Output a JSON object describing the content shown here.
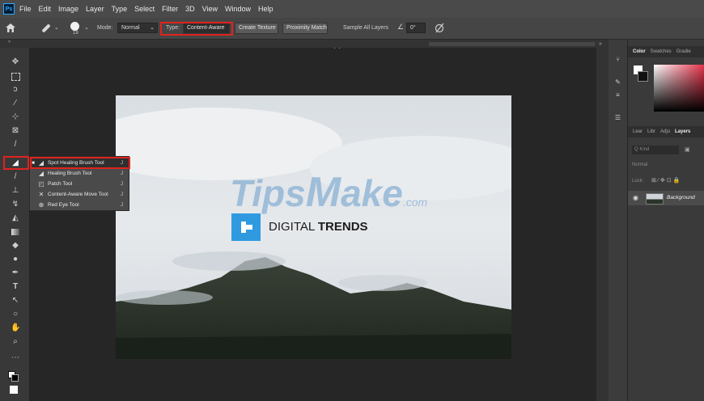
{
  "app": {
    "logo": "Ps"
  },
  "menubar": {
    "items": [
      "File",
      "Edit",
      "Image",
      "Layer",
      "Type",
      "Select",
      "Filter",
      "3D",
      "View",
      "Window",
      "Help"
    ]
  },
  "options": {
    "brush_size": "19",
    "mode_label": "Mode:",
    "mode_value": "Normal",
    "type_label": "Type:",
    "type_value": "Content-Aware",
    "create_texture": "Create Texture",
    "proximity_match": "Proximity Match",
    "sample_all_layers": "Sample All Layers",
    "angle_value": "0°"
  },
  "flyout": {
    "items": [
      {
        "label": "Spot Healing Brush Tool",
        "icon": "spot-healing-brush-icon",
        "selected": true,
        "shortcut": "J"
      },
      {
        "label": "Healing Brush Tool",
        "icon": "healing-brush-icon",
        "selected": false,
        "shortcut": "J"
      },
      {
        "label": "Patch Tool",
        "icon": "patch-icon",
        "selected": false,
        "shortcut": "J"
      },
      {
        "label": "Content-Aware Move Tool",
        "icon": "content-aware-move-icon",
        "selected": false,
        "shortcut": "J"
      },
      {
        "label": "Red Eye Tool",
        "icon": "red-eye-icon",
        "selected": false,
        "shortcut": "J"
      }
    ]
  },
  "image": {
    "watermark": {
      "t1": "T",
      "t2": "ips",
      "m": "M",
      "ake": "ake",
      "com": ".com"
    },
    "brand": {
      "prefix": "DIGITAL",
      "bold": "TRENDS"
    }
  },
  "panels": {
    "color_tabs": [
      "Color",
      "Swatches",
      "Gradie"
    ],
    "layers_tabs": [
      "Lear",
      "Libr",
      "Adju",
      "Layers"
    ],
    "search_placeholder": "Q Kind",
    "blend_mode": "Normal",
    "lock_label": "Lock:",
    "layer_name": "Background"
  },
  "colors": {
    "highlight": "#e0231f",
    "ps_blue": "#31a8ff"
  }
}
